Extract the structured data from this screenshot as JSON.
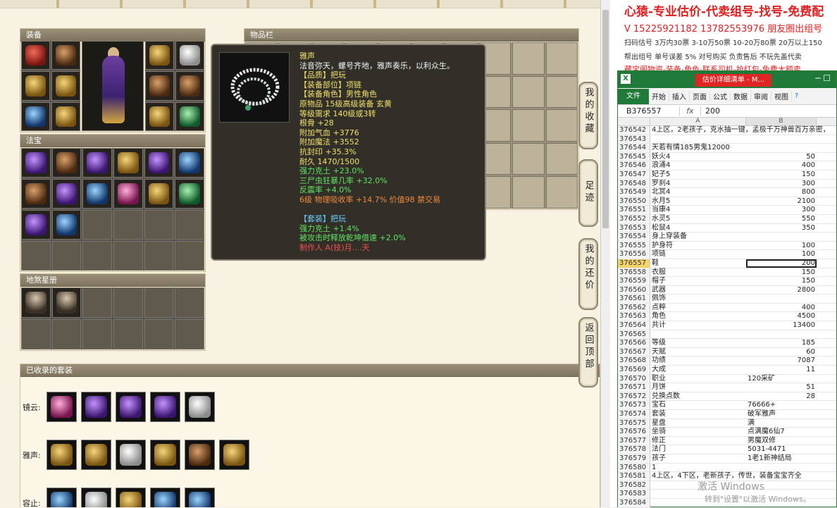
{
  "panels": {
    "equipment": "装备",
    "fabao": "法宝",
    "dishaxing": "地煞星册",
    "items": "物品栏",
    "collected_sets": "已收录的套装"
  },
  "tooltip": {
    "lines": [
      {
        "text": "雅声",
        "color": "y"
      },
      {
        "text": "法音弥天，螺号齐地，雅声奏乐，以利众生。",
        "color": "w"
      },
      {
        "text": "【品质】把玩",
        "color": "y"
      },
      {
        "text": "【装备部位】项链",
        "color": "y"
      },
      {
        "text": "【装备角色】男性角色",
        "color": "y"
      },
      {
        "text": "原物品 15级高级装备 玄黄",
        "color": "y"
      },
      {
        "text": "等级需求 140级或3转",
        "color": "y"
      },
      {
        "text": "根骨 +28",
        "color": "y"
      },
      {
        "text": "附加气血 +3776",
        "color": "y"
      },
      {
        "text": "附加魔法 +3552",
        "color": "y"
      },
      {
        "text": "抗封印 +35.3%",
        "color": "y"
      },
      {
        "text": "耐久 1470/1500",
        "color": "y"
      },
      {
        "text": "强力克土 +23.0%",
        "color": "g"
      },
      {
        "text": "三尸虫狂暴几率 +32.0%",
        "color": "g"
      },
      {
        "text": "反震率 +4.0%",
        "color": "g"
      },
      {
        "text": "6级 物理吸收率 +14.7% 价值98 禁交易",
        "color": "o"
      },
      {
        "text": "",
        "color": "w"
      },
      {
        "text": "【套装】把玩",
        "color": "b"
      },
      {
        "text": "强力克土 +1.4%",
        "color": "g"
      },
      {
        "text": "被攻击时释放乾坤借速 +2.0%",
        "color": "g"
      },
      {
        "text": "制作人 A(技)月....天",
        "color": "r"
      }
    ]
  },
  "side_buttons": [
    {
      "label": "我的收藏"
    },
    {
      "label": "足迹"
    },
    {
      "label": "我的还价"
    },
    {
      "label": "返回顶部"
    }
  ],
  "suits": [
    {
      "label": "镜云:",
      "count": 5
    },
    {
      "label": "雅声:",
      "count": 6
    },
    {
      "label": "容止:",
      "count": 5
    }
  ],
  "right_header": {
    "line1": "心猿-专业估价-代卖组号-找号-免费配",
    "line2": "V 15225921182   13782553976 朋友圈出组号",
    "line3": "扫码估号 3万内30票  3-10万50票  10-20万80票  20万以上150",
    "line4": "帮出组号 单号误差 5% 对号购买 负责售后 不玩先盖代卖",
    "line5": "藏宝阁物资-装备-角色-联系司机-抢红包-免费大额卖"
  },
  "excel": {
    "title_tab": "估价详细清单 - M...",
    "ribbon_file": "文件",
    "ribbon_tabs": [
      "开始",
      "插入",
      "页面",
      "公式",
      "数据",
      "审阅",
      "视图"
    ],
    "name_box": "B376557",
    "fx": "fx",
    "formula_value": "200",
    "col_a": "A",
    "col_b": "B",
    "rows": [
      {
        "n": "376542",
        "a": "4上区，2老孩子，克水抽一键，孟极千万神兽百万亲密，",
        "b": ""
      },
      {
        "n": "376543",
        "a": "",
        "b": ""
      },
      {
        "n": "376544",
        "a": "天若有情185男鬼12000",
        "b": ""
      },
      {
        "n": "376545",
        "a": "妖火4",
        "b": "50"
      },
      {
        "n": "376546",
        "a": "浪涌4",
        "b": "400"
      },
      {
        "n": "376547",
        "a": "妃子5",
        "b": "150"
      },
      {
        "n": "376548",
        "a": "罗刹4",
        "b": "300"
      },
      {
        "n": "376549",
        "a": "北冥4",
        "b": "800"
      },
      {
        "n": "376550",
        "a": "水月5",
        "b": "2100"
      },
      {
        "n": "376551",
        "a": "当康4",
        "b": "300"
      },
      {
        "n": "376552",
        "a": "水灵5",
        "b": "550"
      },
      {
        "n": "376553",
        "a": "松鼠4",
        "b": "350"
      },
      {
        "n": "376554",
        "a": "身上穿装备",
        "b": ""
      },
      {
        "n": "376555",
        "a": "护身符",
        "b": "100"
      },
      {
        "n": "376556",
        "a": "项链",
        "b": "100"
      },
      {
        "n": "376557",
        "a": "鞋",
        "b": "200",
        "sel": true
      },
      {
        "n": "376558",
        "a": "衣服",
        "b": "150"
      },
      {
        "n": "376559",
        "a": "帽子",
        "b": "150"
      },
      {
        "n": "376560",
        "a": "武器",
        "b": "2800"
      },
      {
        "n": "376561",
        "a": "佩饰",
        "b": ""
      },
      {
        "n": "376562",
        "a": "点粹",
        "b": "400"
      },
      {
        "n": "376563",
        "a": "角色",
        "b": "4500"
      },
      {
        "n": "376564",
        "a": "共计",
        "b": "13400"
      },
      {
        "n": "376565",
        "a": "",
        "b": ""
      },
      {
        "n": "376566",
        "a": "等级",
        "b": "185"
      },
      {
        "n": "376567",
        "a": "天赋",
        "b": "60"
      },
      {
        "n": "376568",
        "a": "功绩",
        "b": "7087"
      },
      {
        "n": "376569",
        "a": "大成",
        "b": "11"
      },
      {
        "n": "376570",
        "a": "职业",
        "b": "120采矿",
        "left": true
      },
      {
        "n": "376571",
        "a": "月饼",
        "b": "51"
      },
      {
        "n": "376572",
        "a": "兑换点数",
        "b": "28"
      },
      {
        "n": "376573",
        "a": "宝石",
        "b": "76666+",
        "left": true
      },
      {
        "n": "376574",
        "a": "套装",
        "b": "破军雅声",
        "left": true
      },
      {
        "n": "376575",
        "a": "星盘",
        "b": "满",
        "left": true
      },
      {
        "n": "376576",
        "a": "坐骑",
        "b": "点满魔6仙7",
        "left": true
      },
      {
        "n": "376577",
        "a": "修正",
        "b": "男魔双修",
        "left": true
      },
      {
        "n": "376578",
        "a": "法门",
        "b": "5031-4471",
        "left": true
      },
      {
        "n": "376579",
        "a": "孩子",
        "b": "1老1新神结局",
        "left": true
      },
      {
        "n": "376580",
        "a": "                              1",
        "b": ""
      },
      {
        "n": "376581",
        "a": "4上区，4下区，老新孩子，传世，装备宝宝齐全",
        "b": ""
      },
      {
        "n": "376582",
        "a": "",
        "b": ""
      },
      {
        "n": "376583",
        "a": "",
        "b": ""
      },
      {
        "n": "376584",
        "a": "",
        "b": ""
      }
    ]
  },
  "watermark": {
    "line1": "激活 Windows",
    "line2": "转到\"设置\"以激活 Windows。"
  }
}
